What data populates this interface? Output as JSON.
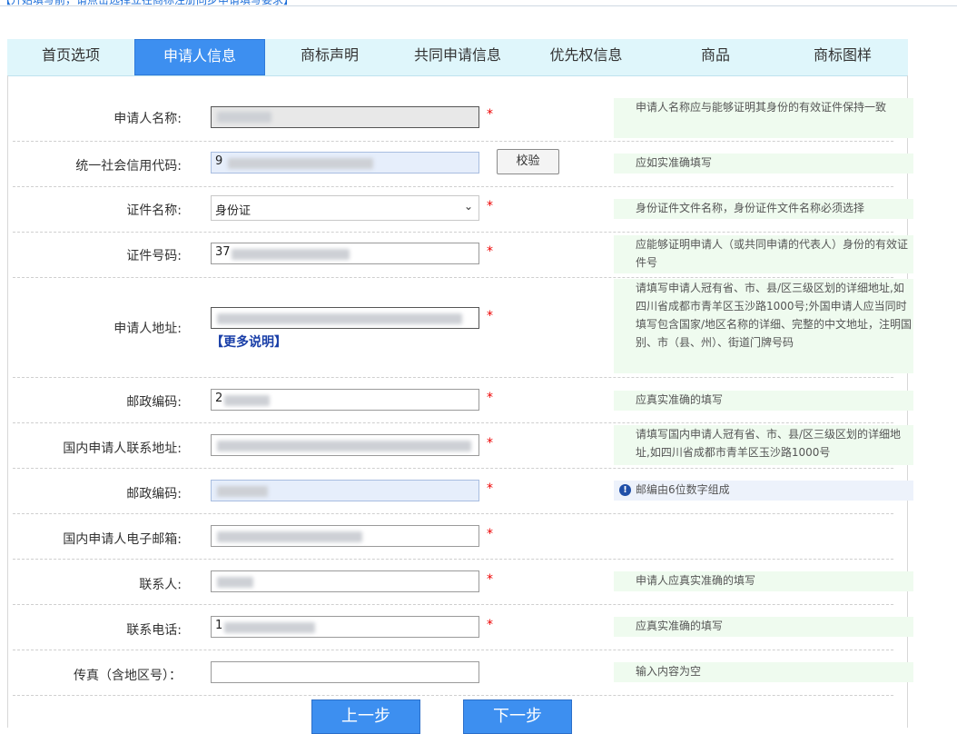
{
  "banner": "【升始填写前，请点击选择立在商标注册同步申请填写要求】",
  "tabs": [
    "首页选项",
    "申请人信息",
    "商标声明",
    "共同申请信息",
    "优先权信息",
    "商品",
    "商标图样"
  ],
  "form": {
    "applicant_name_label": "申请人名称:",
    "applicant_name_tip": "申请人名称应与能够证明其身份的有效证件保持一致",
    "credit_code_label": "统一社会信用代码:",
    "credit_code_value": "9",
    "check_button": "校验",
    "credit_code_tip": "应如实准确填写",
    "cert_name_label": "证件名称:",
    "cert_name_value": "身份证",
    "cert_name_tip": "身份证件文件名称，身份证件文件名称必须选择",
    "cert_no_label": "证件号码:",
    "cert_no_value": "37",
    "cert_no_tip": "应能够证明申请人（或共同申请的代表人）身份的有效证件号",
    "address_label": "申请人地址:",
    "address_more": "【更多说明】",
    "address_tip": "请填写申请人冠有省、市、县/区三级区划的详细地址,如四川省成都市青羊区玉沙路1000号;外国申请人应当同时填写包含国家/地区名称的详细、完整的中文地址，注明国别、市（县、州）、街道门牌号码",
    "postcode_label": "邮政编码:",
    "postcode_value": "2",
    "postcode_tip": "应真实准确的填写",
    "domestic_address_label": "国内申请人联系地址:",
    "domestic_address_tip": "请填写国内申请人冠有省、市、县/区三级区划的详细地址,如四川省成都市青羊区玉沙路1000号",
    "postcode2_label": "邮政编码:",
    "postcode2_tip": "邮编由6位数字组成",
    "email_label": "国内申请人电子邮箱:",
    "contact_label": "联系人:",
    "contact_tip": "申请人应真实准确的填写",
    "phone_label": "联系电话:",
    "phone_value": "1",
    "phone_tip": "应真实准确的填写",
    "fax_label": "传真（含地区号）：",
    "fax_tip": "输入内容为空",
    "required_mark": "*"
  },
  "buttons": {
    "prev": "上一步",
    "next": "下一步"
  },
  "icons": {
    "info": "info-circle-icon",
    "dropdown": "chevron-down-icon"
  }
}
